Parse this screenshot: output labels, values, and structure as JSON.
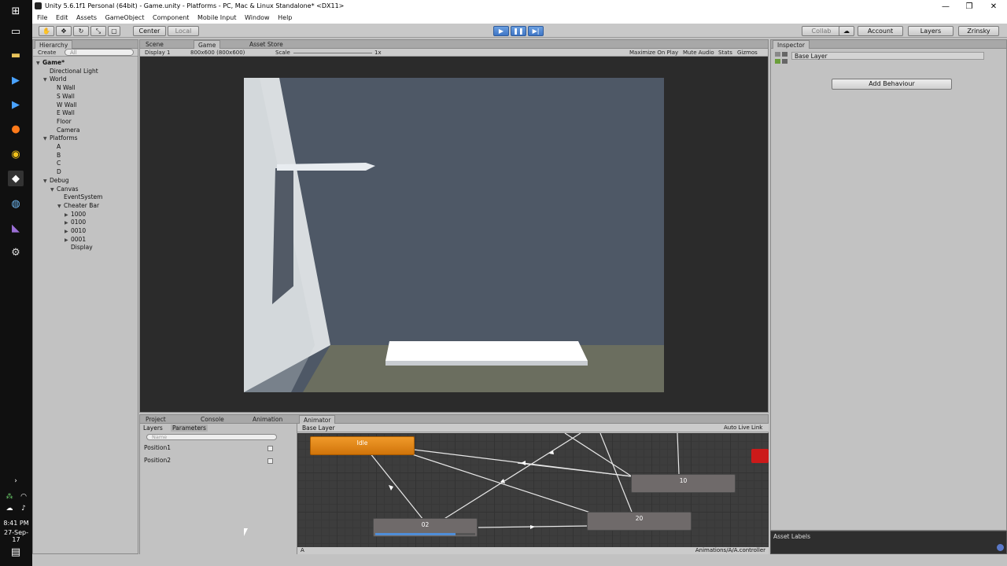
{
  "titlebar": {
    "title": "Unity 5.6.1f1 Personal (64bit) - Game.unity - Platforms - PC, Mac & Linux Standalone* <DX11>",
    "minimize": "—",
    "restore": "❐",
    "close": "✕"
  },
  "menu": [
    "File",
    "Edit",
    "Assets",
    "GameObject",
    "Component",
    "Mobile Input",
    "Window",
    "Help"
  ],
  "toolbar": {
    "center": "Center",
    "local": "Local",
    "collab": "Collab",
    "account": "Account",
    "layers": "Layers",
    "layout": "Zrinsky"
  },
  "hierarchy": {
    "tab": "Hierarchy",
    "create": "Create",
    "search_placeholder": "All",
    "items": [
      {
        "label": "Game*",
        "indent": 0,
        "arrow": "▼"
      },
      {
        "label": "Directional Light",
        "indent": 1,
        "arrow": ""
      },
      {
        "label": "World",
        "indent": 1,
        "arrow": "▼"
      },
      {
        "label": "N Wall",
        "indent": 2,
        "arrow": ""
      },
      {
        "label": "S Wall",
        "indent": 2,
        "arrow": ""
      },
      {
        "label": "W Wall",
        "indent": 2,
        "arrow": ""
      },
      {
        "label": "E Wall",
        "indent": 2,
        "arrow": ""
      },
      {
        "label": "Floor",
        "indent": 2,
        "arrow": ""
      },
      {
        "label": "Camera",
        "indent": 2,
        "arrow": ""
      },
      {
        "label": "Platforms",
        "indent": 1,
        "arrow": "▼"
      },
      {
        "label": "A",
        "indent": 2,
        "arrow": ""
      },
      {
        "label": "B",
        "indent": 2,
        "arrow": ""
      },
      {
        "label": "C",
        "indent": 2,
        "arrow": ""
      },
      {
        "label": "D",
        "indent": 2,
        "arrow": ""
      },
      {
        "label": "Debug",
        "indent": 1,
        "arrow": "▼"
      },
      {
        "label": "Canvas",
        "indent": 2,
        "arrow": "▼"
      },
      {
        "label": "EventSystem",
        "indent": 3,
        "arrow": ""
      },
      {
        "label": "Cheater Bar",
        "indent": 3,
        "arrow": "▼"
      },
      {
        "label": "1000",
        "indent": 4,
        "arrow": "▶"
      },
      {
        "label": "0100",
        "indent": 4,
        "arrow": "▶"
      },
      {
        "label": "0010",
        "indent": 4,
        "arrow": "▶"
      },
      {
        "label": "0001",
        "indent": 4,
        "arrow": "▶"
      },
      {
        "label": "Display",
        "indent": 4,
        "arrow": ""
      }
    ]
  },
  "viewtabs": {
    "scene": "Scene",
    "game": "Game",
    "store": "Asset Store"
  },
  "gamebar": {
    "display": "Display 1",
    "resolution": "800x600 (800x600)",
    "scale_label": "Scale",
    "scale_value": "1x",
    "maximize": "Maximize On Play",
    "mute": "Mute Audio",
    "stats": "Stats",
    "gizmos": "Gizmos"
  },
  "inspector": {
    "tab": "Inspector",
    "layer_name": "Base Layer",
    "add_behaviour": "Add Behaviour",
    "asset_labels": "Asset Labels"
  },
  "bottomtabs": {
    "project": "Project",
    "console": "Console",
    "animation": "Animation",
    "animator": "Animator"
  },
  "animator": {
    "layers_tab": "Layers",
    "parameters_tab": "Parameters",
    "base_layer": "Base Layer",
    "auto_live_link": "Auto Live Link",
    "search_placeholder": "Name",
    "parameters": [
      "Position1",
      "Position2"
    ],
    "states": {
      "idle": "Idle",
      "s10": "10",
      "s20": "20",
      "s02": "02"
    },
    "state02_progress": 0.8,
    "footer_left": "A",
    "footer_right": "Animations/A/A.controller"
  },
  "taskbar": {
    "time": "8:41 PM",
    "date": "27-Sep-17"
  },
  "colors": {
    "idle_state": "#e08418",
    "play_active": "#4f86d6",
    "canvas_bg": "#4e5866"
  }
}
